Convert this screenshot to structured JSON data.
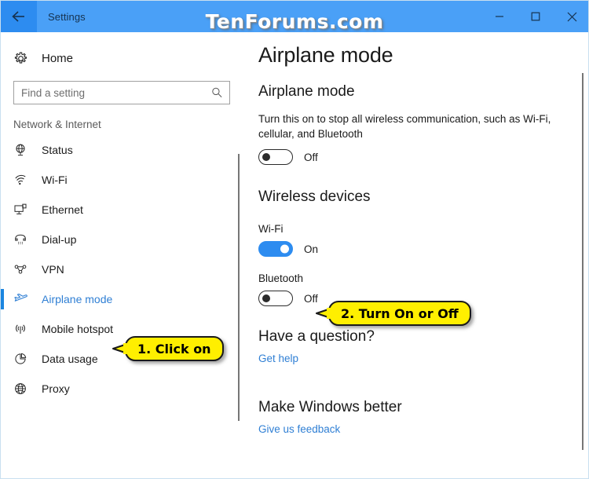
{
  "window": {
    "title": "Settings",
    "back_icon": "back-arrow-icon",
    "minimize_label": "Minimize",
    "maximize_label": "Maximize",
    "close_label": "Close",
    "titlebar_color": "#4aa0f7",
    "accent_color": "#2d8cf0"
  },
  "watermark": {
    "text": "TenForums.com"
  },
  "sidebar": {
    "home": {
      "label": "Home",
      "icon": "gear-icon"
    },
    "search": {
      "value": "",
      "placeholder": "Find a setting",
      "icon": "search-icon"
    },
    "group_header": "Network & Internet",
    "items": [
      {
        "label": "Status",
        "icon": "network-status-icon",
        "selected": false
      },
      {
        "label": "Wi-Fi",
        "icon": "wifi-icon",
        "selected": false
      },
      {
        "label": "Ethernet",
        "icon": "ethernet-icon",
        "selected": false
      },
      {
        "label": "Dial-up",
        "icon": "dialup-phone-icon",
        "selected": false
      },
      {
        "label": "VPN",
        "icon": "vpn-icon",
        "selected": false
      },
      {
        "label": "Airplane mode",
        "icon": "airplane-icon",
        "selected": true
      },
      {
        "label": "Mobile hotspot",
        "icon": "mobile-hotspot-icon",
        "selected": false
      },
      {
        "label": "Data usage",
        "icon": "data-usage-pie-icon",
        "selected": false
      },
      {
        "label": "Proxy",
        "icon": "globe-icon",
        "selected": false
      }
    ]
  },
  "main": {
    "page_title": "Airplane mode",
    "airplane_section": {
      "heading": "Airplane mode",
      "description": "Turn this on to stop all wireless communication, such as Wi-Fi, cellular, and Bluetooth",
      "toggle": {
        "state": "Off",
        "on": false
      }
    },
    "wireless_section": {
      "heading": "Wireless devices",
      "devices": [
        {
          "label": "Wi-Fi",
          "state": "On",
          "on": true
        },
        {
          "label": "Bluetooth",
          "state": "Off",
          "on": false
        }
      ]
    },
    "help_section": {
      "heading": "Have a question?",
      "link": "Get help"
    },
    "feedback_section": {
      "heading": "Make Windows better",
      "link": "Give us feedback"
    }
  },
  "callouts": [
    {
      "text": "1. Click on",
      "target": "sidebar-item-airplane-mode"
    },
    {
      "text": "2. Turn On or Off",
      "target": "bluetooth-toggle"
    }
  ]
}
